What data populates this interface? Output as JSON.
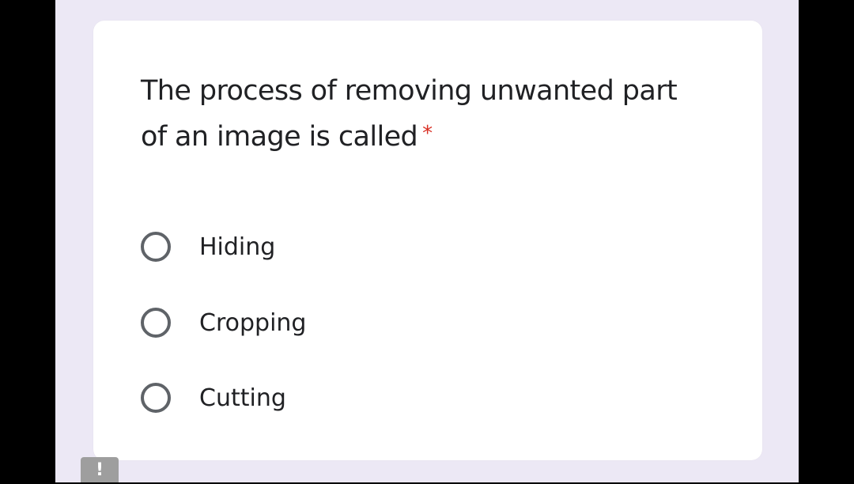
{
  "question": {
    "text": "The process of removing unwanted part of an image is called",
    "required_marker": "*"
  },
  "options": [
    {
      "label": "Hiding",
      "selected": false
    },
    {
      "label": "Cropping",
      "selected": false
    },
    {
      "label": "Cutting",
      "selected": false
    }
  ],
  "report_button": {
    "icon": "exclamation-icon",
    "glyph": "!"
  },
  "colors": {
    "background": "#ece8f5",
    "card": "#ffffff",
    "text": "#202124",
    "required": "#d93025",
    "radio_border": "#5f6368"
  }
}
